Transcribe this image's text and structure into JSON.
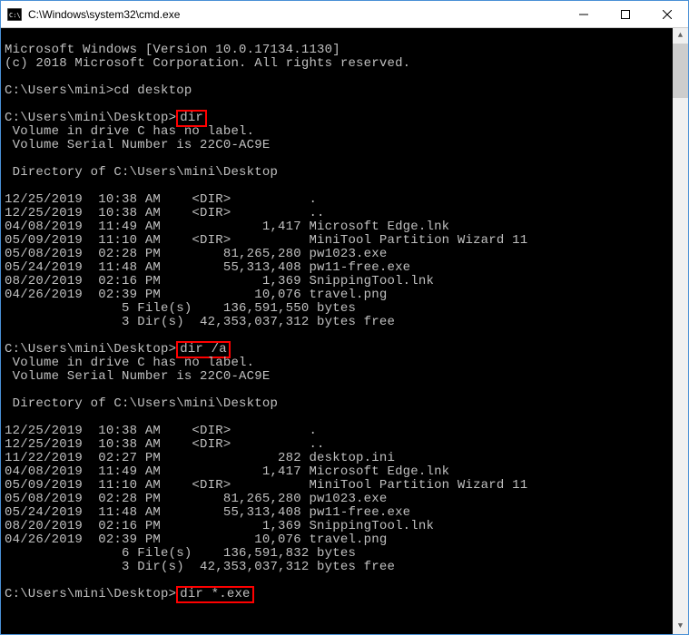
{
  "titlebar": {
    "title": "C:\\Windows\\system32\\cmd.exe",
    "minimize": "—",
    "maximize": "□",
    "close": "✕"
  },
  "terminal": {
    "line1": "Microsoft Windows [Version 10.0.17134.1130]",
    "line2": "(c) 2018 Microsoft Corporation. All rights reserved.",
    "blank1": "",
    "prompt1_pre": "C:\\Users\\mini>",
    "prompt1_cmd": "cd desktop",
    "blank2": "",
    "prompt2_pre": "C:\\Users\\mini\\Desktop>",
    "cmd_dir": "dir",
    "vol1": " Volume in drive C has no label.",
    "vol2": " Volume Serial Number is 22C0-AC9E",
    "blank3": "",
    "dirof1": " Directory of C:\\Users\\mini\\Desktop",
    "blank4": "",
    "r1_1": "12/25/2019  10:38 AM    <DIR>          .",
    "r1_2": "12/25/2019  10:38 AM    <DIR>          ..",
    "r1_3": "04/08/2019  11:49 AM             1,417 Microsoft Edge.lnk",
    "r1_4": "05/09/2019  11:10 AM    <DIR>          MiniTool Partition Wizard 11",
    "r1_5": "05/08/2019  02:28 PM        81,265,280 pw1023.exe",
    "r1_6": "05/24/2019  11:48 AM        55,313,408 pw11-free.exe",
    "r1_7": "08/20/2019  02:16 PM             1,369 SnippingTool.lnk",
    "r1_8": "04/26/2019  02:39 PM            10,076 travel.png",
    "r1_9": "               5 File(s)    136,591,550 bytes",
    "r1_10": "               3 Dir(s)  42,353,037,312 bytes free",
    "blank5": "",
    "prompt3_pre": "C:\\Users\\mini\\Desktop>",
    "cmd_dir_a": "dir /a",
    "vol3": " Volume in drive C has no label.",
    "vol4": " Volume Serial Number is 22C0-AC9E",
    "blank6": "",
    "dirof2": " Directory of C:\\Users\\mini\\Desktop",
    "blank7": "",
    "r2_1": "12/25/2019  10:38 AM    <DIR>          .",
    "r2_2": "12/25/2019  10:38 AM    <DIR>          ..",
    "r2_3": "11/22/2019  02:27 PM               282 desktop.ini",
    "r2_4": "04/08/2019  11:49 AM             1,417 Microsoft Edge.lnk",
    "r2_5": "05/09/2019  11:10 AM    <DIR>          MiniTool Partition Wizard 11",
    "r2_6": "05/08/2019  02:28 PM        81,265,280 pw1023.exe",
    "r2_7": "05/24/2019  11:48 AM        55,313,408 pw11-free.exe",
    "r2_8": "08/20/2019  02:16 PM             1,369 SnippingTool.lnk",
    "r2_9": "04/26/2019  02:39 PM            10,076 travel.png",
    "r2_10": "               6 File(s)    136,591,832 bytes",
    "r2_11": "               3 Dir(s)  42,353,037,312 bytes free",
    "blank8": "",
    "prompt4_pre": "C:\\Users\\mini\\Desktop>",
    "cmd_dir_exe": "dir *.exe"
  },
  "highlights": [
    "dir",
    "dir /a",
    "dir *.exe"
  ]
}
